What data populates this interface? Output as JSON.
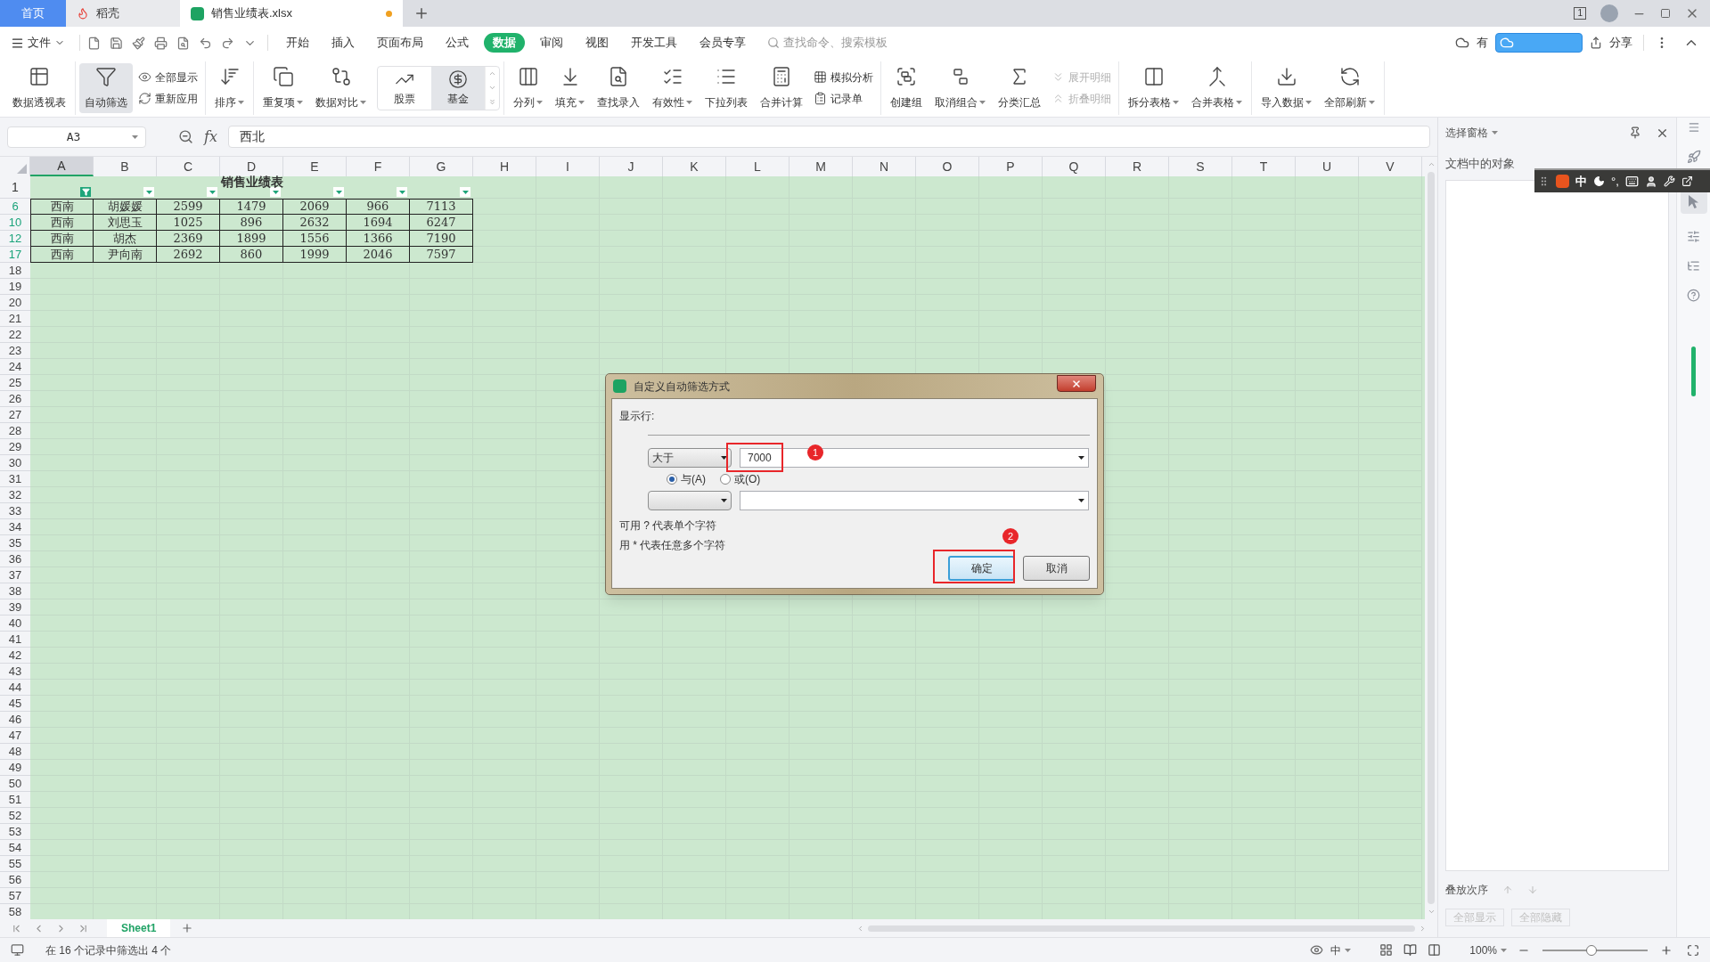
{
  "tabs": [
    {
      "label": "首页",
      "kind": "home",
      "selected": false,
      "unsaved": false
    },
    {
      "label": "稻壳",
      "kind": "app",
      "selected": false,
      "unsaved": false
    },
    {
      "label": "销售业绩表.xlsx",
      "kind": "doc",
      "selected": true,
      "unsaved": true
    }
  ],
  "window_count": "1",
  "menu": {
    "file": "文件",
    "items": [
      {
        "label": "开始",
        "selected": false
      },
      {
        "label": "插入",
        "selected": false
      },
      {
        "label": "页面布局",
        "selected": false
      },
      {
        "label": "公式",
        "selected": false
      },
      {
        "label": "数据",
        "selected": true
      },
      {
        "label": "审阅",
        "selected": false
      },
      {
        "label": "视图",
        "selected": false
      },
      {
        "label": "开发工具",
        "selected": false
      },
      {
        "label": "会员专享",
        "selected": false
      }
    ],
    "search_placeholder": "查找命令、搜索模板",
    "cloud_label": "有",
    "share": "分享"
  },
  "ribbon_groups": [
    {
      "items": [
        {
          "kind": "large",
          "label": "数据透视表",
          "pressed": false,
          "dropdown": false
        }
      ]
    },
    {
      "items": [
        {
          "kind": "large",
          "label": "自动筛选",
          "pressed": true,
          "dropdown": false
        },
        {
          "kind": "stack",
          "items": [
            {
              "label": "全部显示",
              "disabled": false
            },
            {
              "label": "重新应用",
              "disabled": false
            }
          ]
        }
      ]
    },
    {
      "items": [
        {
          "kind": "large",
          "label": "排序",
          "pressed": false,
          "dropdown": true
        }
      ]
    },
    {
      "items": [
        {
          "kind": "large",
          "label": "重复项",
          "pressed": false,
          "dropdown": true
        },
        {
          "kind": "large",
          "label": "数据对比",
          "pressed": false,
          "dropdown": true
        },
        {
          "kind": "gallery",
          "items": [
            {
              "label": "股票",
              "pressed": false
            },
            {
              "label": "基金",
              "pressed": true
            }
          ]
        }
      ]
    },
    {
      "items": [
        {
          "kind": "large",
          "label": "分列",
          "pressed": false,
          "dropdown": true
        },
        {
          "kind": "large",
          "label": "填充",
          "pressed": false,
          "dropdown": true
        },
        {
          "kind": "large",
          "label": "查找录入",
          "pressed": false,
          "dropdown": false
        },
        {
          "kind": "large",
          "label": "有效性",
          "pressed": false,
          "dropdown": true
        },
        {
          "kind": "large",
          "label": "下拉列表",
          "pressed": false,
          "dropdown": false
        },
        {
          "kind": "large",
          "label": "合并计算",
          "pressed": false,
          "dropdown": false
        },
        {
          "kind": "stack",
          "items": [
            {
              "label": "模拟分析",
              "disabled": false
            },
            {
              "label": "记录单",
              "disabled": false
            }
          ]
        }
      ]
    },
    {
      "items": [
        {
          "kind": "large",
          "label": "创建组",
          "pressed": false,
          "dropdown": false
        },
        {
          "kind": "large",
          "label": "取消组合",
          "pressed": false,
          "dropdown": true
        },
        {
          "kind": "large",
          "label": "分类汇总",
          "pressed": false,
          "dropdown": false
        },
        {
          "kind": "stack",
          "items": [
            {
              "label": "展开明细",
              "disabled": true
            },
            {
              "label": "折叠明细",
              "disabled": true
            }
          ]
        }
      ]
    },
    {
      "items": [
        {
          "kind": "large",
          "label": "拆分表格",
          "pressed": false,
          "dropdown": true
        },
        {
          "kind": "large",
          "label": "合并表格",
          "pressed": false,
          "dropdown": true
        }
      ]
    },
    {
      "items": [
        {
          "kind": "large",
          "label": "导入数据",
          "pressed": false,
          "dropdown": true
        },
        {
          "kind": "large",
          "label": "全部刷新",
          "pressed": false,
          "dropdown": true
        }
      ]
    }
  ],
  "formula_bar": {
    "name_box": "A3",
    "fx": "fx",
    "value": "西北"
  },
  "columns": [
    {
      "label": "A",
      "selected": true
    },
    {
      "label": "B",
      "selected": false
    },
    {
      "label": "C",
      "selected": false
    },
    {
      "label": "D",
      "selected": false
    },
    {
      "label": "E",
      "selected": false
    },
    {
      "label": "F",
      "selected": false
    },
    {
      "label": "G",
      "selected": false
    },
    {
      "label": "H",
      "selected": false
    },
    {
      "label": "I",
      "selected": false
    },
    {
      "label": "J",
      "selected": false
    },
    {
      "label": "K",
      "selected": false
    },
    {
      "label": "L",
      "selected": false
    },
    {
      "label": "M",
      "selected": false
    },
    {
      "label": "N",
      "selected": false
    },
    {
      "label": "O",
      "selected": false
    },
    {
      "label": "P",
      "selected": false
    },
    {
      "label": "Q",
      "selected": false
    },
    {
      "label": "R",
      "selected": false
    },
    {
      "label": "S",
      "selected": false
    },
    {
      "label": "T",
      "selected": false
    },
    {
      "label": "U",
      "selected": false
    },
    {
      "label": "V",
      "selected": false
    }
  ],
  "title_row": {
    "number": "1",
    "title": "销售业绩表",
    "filters": [
      {
        "active": true
      },
      {
        "active": false
      },
      {
        "active": false
      },
      {
        "active": false
      },
      {
        "active": false
      },
      {
        "active": false
      },
      {
        "active": false
      }
    ]
  },
  "rows": [
    {
      "number": "6",
      "filtered": true,
      "cells": [
        "西南",
        "胡媛媛",
        "2599",
        "1479",
        "2069",
        "966",
        "7113"
      ]
    },
    {
      "number": "10",
      "filtered": true,
      "cells": [
        "西南",
        "刘思玉",
        "1025",
        "896",
        "2632",
        "1694",
        "6247"
      ]
    },
    {
      "number": "12",
      "filtered": true,
      "cells": [
        "西南",
        "胡杰",
        "2369",
        "1899",
        "1556",
        "1366",
        "7190"
      ]
    },
    {
      "number": "17",
      "filtered": true,
      "cells": [
        "西南",
        "尹向南",
        "2692",
        "860",
        "1999",
        "2046",
        "7597"
      ]
    }
  ],
  "empty_rows": [
    "18",
    "19",
    "20",
    "21",
    "22",
    "23",
    "24",
    "25",
    "26",
    "27",
    "28",
    "29",
    "30",
    "31",
    "32",
    "33",
    "34",
    "35",
    "36",
    "37",
    "38",
    "39",
    "40",
    "41",
    "42",
    "43",
    "44",
    "45",
    "46",
    "47",
    "48",
    "49",
    "50",
    "51",
    "52",
    "53",
    "54",
    "55",
    "56",
    "57",
    "58"
  ],
  "sheet_tabs": [
    {
      "label": "Sheet1",
      "selected": true
    }
  ],
  "status": {
    "text": "在 16 个记录中筛选出 4 个",
    "input_mode": "中",
    "zoom": "100%",
    "level": 0.47
  },
  "selection_pane": {
    "title": "选择窗格",
    "objects_label": "文档中的对象",
    "order_label": "叠放次序",
    "buttons": [
      {
        "label": "全部显示",
        "disabled": true
      },
      {
        "label": "全部隐藏",
        "disabled": true
      }
    ]
  },
  "ime_bar": {
    "lang": "中",
    "punct": "°,"
  },
  "dialog": {
    "title": "自定义自动筛选方式",
    "show_rows": "显示行:",
    "condition1": {
      "operator": "大于",
      "value": "7000"
    },
    "join": [
      {
        "label": "与(A)",
        "selected": true
      },
      {
        "label": "或(O)",
        "selected": false
      }
    ],
    "hints": [
      "可用 ? 代表单个字符",
      "用 * 代表任意多个字符"
    ],
    "buttons": [
      {
        "label": "确定",
        "default": true
      },
      {
        "label": "取消",
        "default": false
      }
    ],
    "annotations": [
      "1",
      "2"
    ]
  }
}
